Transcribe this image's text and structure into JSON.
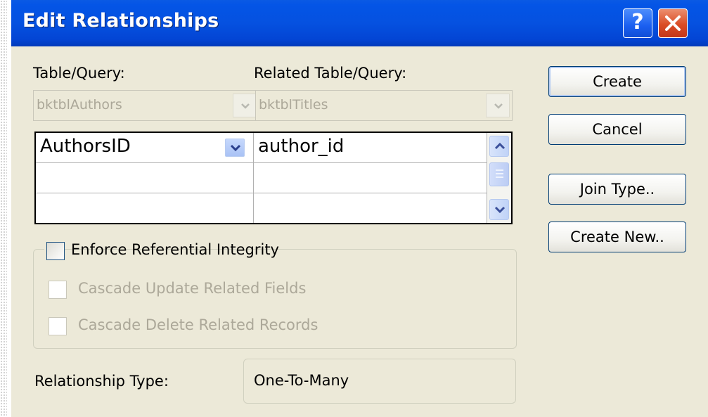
{
  "window": {
    "title": "Edit Relationships",
    "help_glyph": "?",
    "close_icon": "close-x-icon"
  },
  "table_query": {
    "label": "Table/Query:",
    "value": "bktblAuthors"
  },
  "related_table_query": {
    "label": "Related Table/Query:",
    "value": "bktblTitles"
  },
  "field_grid": {
    "rows": [
      {
        "left": "AuthorsID",
        "right": "author_id"
      },
      {
        "left": "",
        "right": ""
      },
      {
        "left": "",
        "right": ""
      }
    ]
  },
  "buttons": {
    "create": "Create",
    "cancel": "Cancel",
    "join_type": "Join Type..",
    "create_new": "Create New.."
  },
  "options": {
    "enforce_ref_integrity": {
      "label": "Enforce Referential Integrity",
      "checked": false,
      "enabled": true
    },
    "cascade_update": {
      "label": "Cascade Update Related Fields",
      "checked": false,
      "enabled": false
    },
    "cascade_delete": {
      "label": "Cascade Delete Related Records",
      "checked": false,
      "enabled": false
    }
  },
  "relationship_type": {
    "label": "Relationship Type:",
    "value": "One-To-Many"
  },
  "colors": {
    "titlebar": "#0455e6",
    "dialog_bg": "#ece9d8",
    "close_button": "#da4c25",
    "disabled_text": "#aca899"
  }
}
